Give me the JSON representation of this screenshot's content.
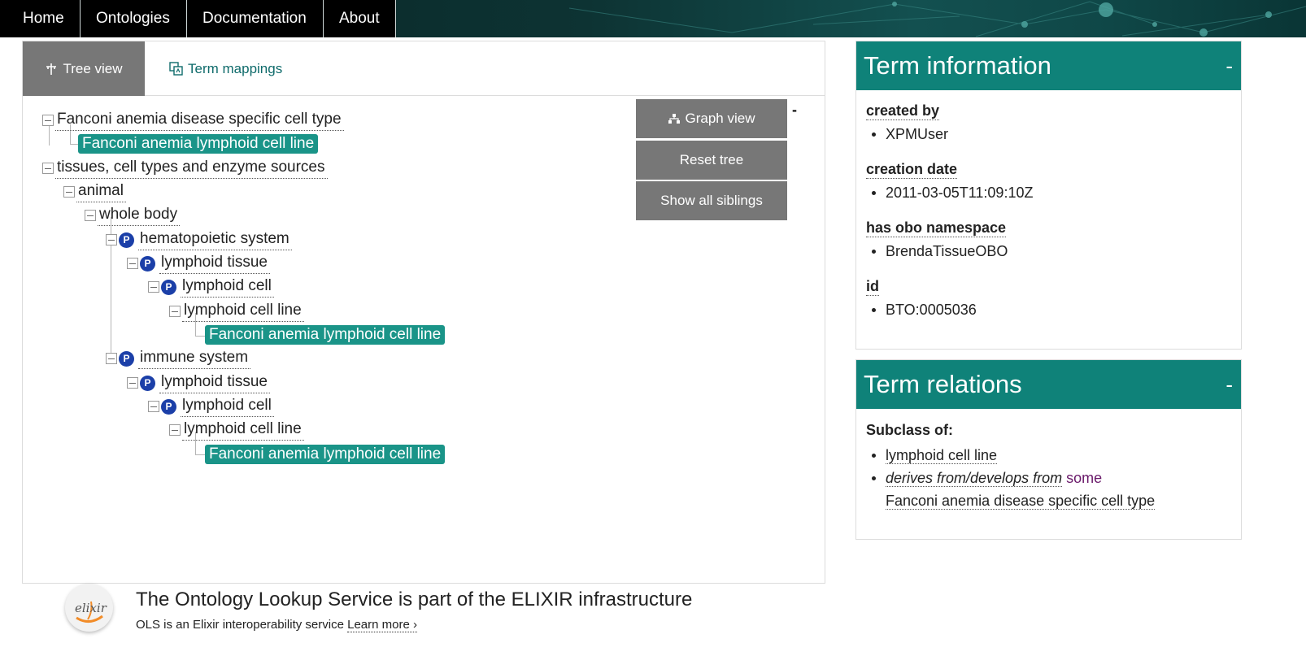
{
  "nav": {
    "items": [
      "Home",
      "Ontologies",
      "Documentation",
      "About"
    ]
  },
  "tabs": {
    "tree_view": "Tree view",
    "term_mappings": "Term mappings"
  },
  "tree": {
    "nodes": [
      "Fanconi anemia disease specific cell type",
      "Fanconi anemia lymphoid cell line",
      "tissues, cell types and enzyme sources",
      "animal",
      "whole body",
      "hematopoietic system",
      "lymphoid tissue",
      "lymphoid cell",
      "lymphoid cell line",
      "Fanconi anemia lymphoid cell line",
      "immune system",
      "lymphoid tissue",
      "lymphoid cell",
      "lymphoid cell line",
      "Fanconi anemia lymphoid cell line"
    ],
    "property_badge": "P",
    "collapse_marker": "-"
  },
  "buttons": {
    "graph_view": "Graph view",
    "reset_tree": "Reset tree",
    "show_all_siblings": "Show all siblings"
  },
  "term_information": {
    "title": "Term information",
    "collapse": "-",
    "properties": [
      {
        "name": "created by",
        "value": "XPMUser"
      },
      {
        "name": "creation date",
        "value": "2011-03-05T11:09:10Z"
      },
      {
        "name": "has obo namespace",
        "value": "BrendaTissueOBO"
      },
      {
        "name": "id",
        "value": "BTO:0005036"
      }
    ]
  },
  "term_relations": {
    "title": "Term relations",
    "collapse": "-",
    "subclass_of_label": "Subclass of:",
    "subclass_1": "lymphoid cell line",
    "relation": "derives from/develops from",
    "quantifier": "some",
    "relation_target": "Fanconi anemia disease specific cell type"
  },
  "footer": {
    "logo_text": "elixir",
    "title": "The Ontology Lookup Service is part of the ELIXIR infrastructure",
    "subtitle": "OLS is an Elixir interoperability service",
    "learn_more": "Learn more ›"
  },
  "colors": {
    "teal": "#0f8279",
    "highlight": "#1a9488",
    "button_gray": "#777777",
    "badge_blue": "#1b3fa8"
  }
}
